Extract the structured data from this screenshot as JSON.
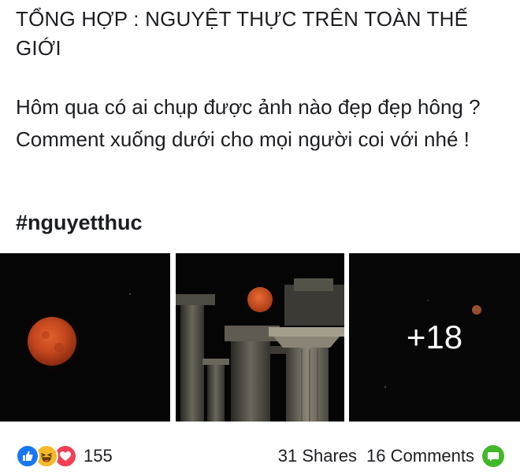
{
  "post": {
    "title": "TỔNG HỢP : NGUYỆT THỰC TRÊN TOÀN THẾ GIỚI",
    "body": "Hôm qua có ai chụp được ảnh nào đẹp đẹp hông ? Comment xuống dưới cho mọi người coi với nhé !",
    "hashtag": "#nguyetthuc"
  },
  "photos": {
    "more_count": "+18"
  },
  "footer": {
    "reaction_count": "155",
    "shares": "31 Shares",
    "comments": "16 Comments",
    "reaction_icons": [
      "like-icon",
      "haha-icon",
      "love-icon"
    ]
  },
  "colors": {
    "like": "#1877f2",
    "haha": "#f7b928",
    "love": "#f33e58",
    "comment": "#42b72a",
    "moon": "#c4471e"
  }
}
